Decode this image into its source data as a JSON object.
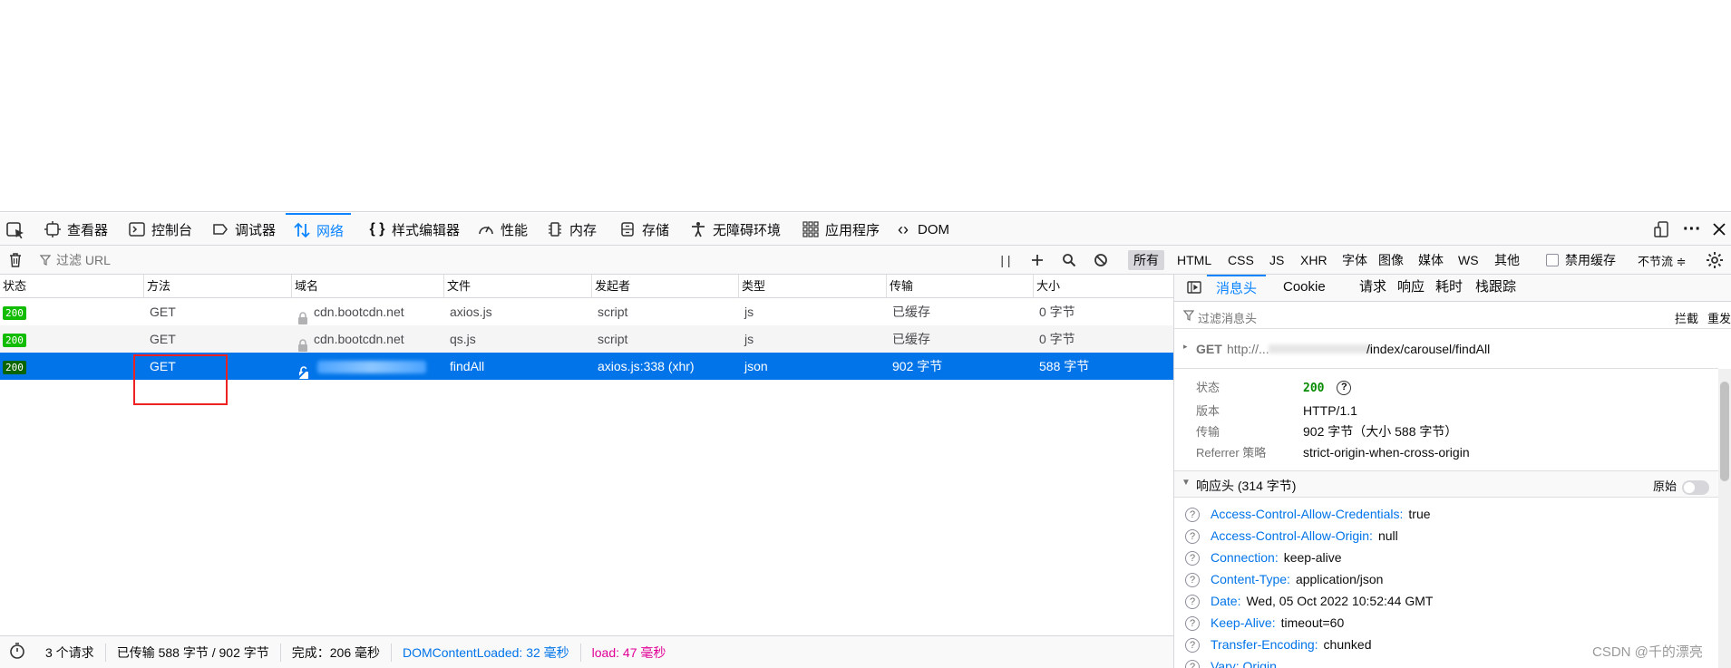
{
  "toolbox": {
    "tabs": [
      {
        "label": "查看器",
        "icon": "inspector-icon"
      },
      {
        "label": "控制台",
        "icon": "console-icon"
      },
      {
        "label": "调试器",
        "icon": "debugger-icon"
      },
      {
        "label": "网络",
        "icon": "network-icon",
        "selected": true
      },
      {
        "label": "样式编辑器",
        "icon": "style-editor-icon"
      },
      {
        "label": "性能",
        "icon": "performance-icon"
      },
      {
        "label": "内存",
        "icon": "memory-icon"
      },
      {
        "label": "存储",
        "icon": "storage-icon"
      },
      {
        "label": "无障碍环境",
        "icon": "accessibility-icon"
      },
      {
        "label": "应用程序",
        "icon": "application-icon"
      },
      {
        "label": "DOM",
        "icon": "dom-icon"
      }
    ]
  },
  "nettools": {
    "filter_placeholder": "过滤 URL",
    "types": [
      "所有",
      "HTML",
      "CSS",
      "JS",
      "XHR",
      "字体",
      "图像",
      "媒体",
      "WS",
      "其他"
    ],
    "disable_cache": "禁用缓存",
    "throttle": "不节流 ≑"
  },
  "table": {
    "columns": [
      "状态",
      "方法",
      "域名",
      "文件",
      "发起者",
      "类型",
      "传输",
      "大小"
    ],
    "rows": [
      {
        "status": "200",
        "method": "GET",
        "domain": "cdn.bootcdn.net",
        "file": "axios.js",
        "initiator": "script",
        "type": "js",
        "transferred": "已缓存",
        "size": "0 字节"
      },
      {
        "status": "200",
        "method": "GET",
        "domain": "cdn.bootcdn.net",
        "file": "qs.js",
        "initiator": "script",
        "type": "js",
        "transferred": "已缓存",
        "size": "0 字节"
      },
      {
        "status": "200",
        "method": "GET",
        "domain": "",
        "file": "findAll",
        "initiator": "axios.js:338 (xhr)",
        "type": "json",
        "transferred": "902 字节",
        "size": "588 字节"
      }
    ]
  },
  "statusbar": {
    "requests": "3 个请求",
    "transferred": "已传输 588 字节 / 902 字节",
    "finish": "完成：206 毫秒",
    "dcl": "DOMContentLoaded: 32 毫秒",
    "load": "load: 47 毫秒"
  },
  "sidebar": {
    "tabs": [
      "消息头",
      "Cookie",
      "请求",
      "响应",
      "耗时",
      "栈跟踪"
    ],
    "filter_placeholder": "过滤消息头",
    "block": "拦截",
    "resend": "重发",
    "summary": {
      "method": "GET",
      "url_prefix": "http://...",
      "url_suffix": "/index/carousel/findAll"
    },
    "status_label": "状态",
    "status_value": "200",
    "version_label": "版本",
    "version_value": "HTTP/1.1",
    "transfer_label": "传输",
    "transfer_value": "902 字节（大小 588 字节）",
    "referrer_label": "Referrer 策略",
    "referrer_value": "strict-origin-when-cross-origin",
    "response_headers_title": "响应头 (314 字节)",
    "raw_label": "原始",
    "headers": [
      {
        "name": "Access-Control-Allow-Credentials:",
        "value": "true"
      },
      {
        "name": "Access-Control-Allow-Origin:",
        "value": "null"
      },
      {
        "name": "Connection:",
        "value": "keep-alive"
      },
      {
        "name": "Content-Type:",
        "value": "application/json"
      },
      {
        "name": "Date:",
        "value": "Wed, 05 Oct 2022 10:52:44 GMT"
      },
      {
        "name": "Keep-Alive:",
        "value": "timeout=60"
      },
      {
        "name": "Transfer-Encoding:",
        "value": "chunked"
      },
      {
        "name": "Vary: Origin",
        "value": ""
      }
    ]
  },
  "watermark": "CSDN @千的漂亮"
}
